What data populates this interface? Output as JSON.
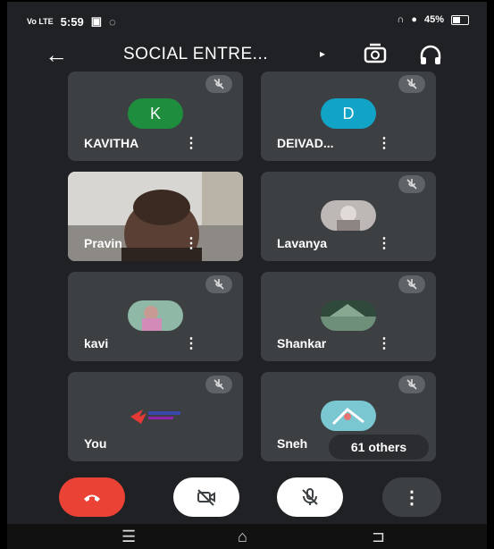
{
  "status_bar": {
    "time": "5:59",
    "signal_label": "Vo LTE",
    "battery": "45%"
  },
  "toolbar": {
    "title": "SOCIAL ENTRE...",
    "back_icon": "arrow-left-icon",
    "title_arrow": "▸"
  },
  "participants": [
    {
      "name": "KAVITHA",
      "initial": "K",
      "color": "#1e8e3e"
    },
    {
      "name": "DEIVAD...",
      "initial": "D",
      "color": "#12a4c7"
    },
    {
      "name": "Pravin"
    },
    {
      "name": "Lavanya"
    },
    {
      "name": "kavi"
    },
    {
      "name": "Shankar"
    },
    {
      "name": "You"
    },
    {
      "name": "Sneh"
    }
  ],
  "others_label": "61 others",
  "menu_glyph": "⋮",
  "colors": {
    "background": "#202124",
    "tile": "#3c4043",
    "end_call": "#ea4335"
  }
}
